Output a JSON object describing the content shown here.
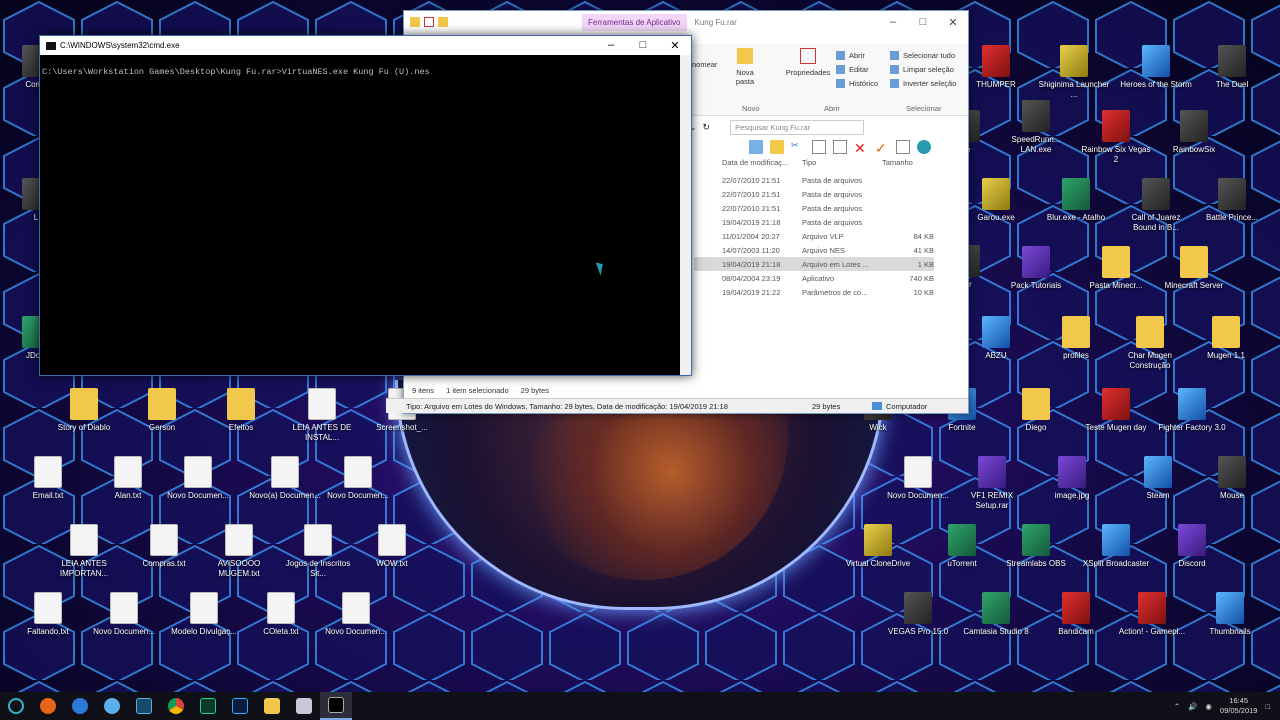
{
  "cmd": {
    "title": "C:\\WINDOWS\\system32\\cmd.exe",
    "line": "C:\\Users\\Workstation Games\\Desktop\\Kung Fu.rar>VirtuaNES.exe Kung Fu (U).nes"
  },
  "explorer": {
    "context_tab": "Ferramentas de Aplicativo",
    "folder_name": "Kung Fu.rar",
    "ribbon": {
      "rename": "nomear",
      "new_folder": "Nova pasta",
      "properties": "Propriedades",
      "open": "Abrir",
      "edit": "Editar",
      "history": "Histórico",
      "select_all": "Selecionar tudo",
      "select_none": "Limpar seleção",
      "invert": "Inverter seleção",
      "group_new": "Novo",
      "group_open": "Abrir",
      "group_select": "Selecionar"
    },
    "search_placeholder": "Pesquisar Kung Fu.rar",
    "columns": {
      "date": "Data de modificaç...",
      "type": "Tipo",
      "size": "Tamanho"
    },
    "rows": [
      {
        "date": "22/07/2010 21:51",
        "type": "Pasta de arquivos",
        "size": ""
      },
      {
        "date": "22/07/2010 21:51",
        "type": "Pasta de arquivos",
        "size": ""
      },
      {
        "date": "22/07/2010 21:51",
        "type": "Pasta de arquivos",
        "size": ""
      },
      {
        "date": "19/04/2019 21:18",
        "type": "Pasta de arquivos",
        "size": ""
      },
      {
        "date": "11/01/2004 20:27",
        "type": "Arquivo VLP",
        "size": "84 KB"
      },
      {
        "date": "14/07/2003 11:20",
        "type": "Arquivo NES",
        "size": "41 KB"
      },
      {
        "date": "19/04/2019 21:18",
        "type": "Arquivo em Lotes ...",
        "size": "1 KB"
      },
      {
        "date": "08/04/2004 23:19",
        "type": "Aplicativo",
        "size": "740 KB"
      },
      {
        "date": "19/04/2019 21:22",
        "type": "Parâmetros de co...",
        "size": "10 KB"
      }
    ],
    "status": {
      "items": "9 itens",
      "selected": "1 item selecionado",
      "bytes": "29 bytes"
    },
    "info": {
      "details": "Tipo: Arquivo em Lotes do Windows, Tamanho: 29 bytes, Data de modificação: 19/04/2019 21:18",
      "size": "29 bytes",
      "location": "Computador"
    }
  },
  "desktop_icons": [
    {
      "label": "THUMPER",
      "kind": "red"
    },
    {
      "label": "Shiginima Launcher ...",
      "kind": "yellow"
    },
    {
      "label": "Heroes of the Storm",
      "kind": "blue"
    },
    {
      "label": "The Duel",
      "kind": "dark"
    },
    {
      "label": "SpeedRunn... LAN.exe",
      "kind": "dark"
    },
    {
      "label": "Rainbow Six Vegas 2",
      "kind": "red"
    },
    {
      "label": "RainbowSix",
      "kind": "dark"
    },
    {
      "label": "Garou.exe",
      "kind": "yellow"
    },
    {
      "label": "Blur.exe - Atalho",
      "kind": "green"
    },
    {
      "label": "Call of Juarez Bound in B...",
      "kind": "dark"
    },
    {
      "label": "Battle Prince...",
      "kind": "dark"
    },
    {
      "label": "Pack Tutoriais",
      "kind": "purple"
    },
    {
      "label": "Pasta Minecr...",
      "kind": "folder"
    },
    {
      "label": "Minecraft Server",
      "kind": "folder"
    },
    {
      "label": "ABZU",
      "kind": "blue"
    },
    {
      "label": "profiles",
      "kind": "folder"
    },
    {
      "label": "Char Mugen Construção",
      "kind": "folder"
    },
    {
      "label": "Mugen 1.1",
      "kind": "folder"
    },
    {
      "label": "Story of Diablo",
      "kind": "folder"
    },
    {
      "label": "Gerson",
      "kind": "folder"
    },
    {
      "label": "Efeitos",
      "kind": "folder"
    },
    {
      "label": "LEIA ANTES DE INSTAL...",
      "kind": "doc"
    },
    {
      "label": "Screenshot_...",
      "kind": "doc"
    },
    {
      "label": "Wick",
      "kind": "dark"
    },
    {
      "label": "Fortnite",
      "kind": "blue"
    },
    {
      "label": "Diego",
      "kind": "folder"
    },
    {
      "label": "Teste Mugen day",
      "kind": "red"
    },
    {
      "label": "Fighter Factory 3.0",
      "kind": "blue"
    },
    {
      "label": "Email.txt",
      "kind": "doc"
    },
    {
      "label": "Alan.txt",
      "kind": "doc"
    },
    {
      "label": "Novo Documen...",
      "kind": "doc"
    },
    {
      "label": "Novo(a) Documen...",
      "kind": "doc"
    },
    {
      "label": "Novo Documen...",
      "kind": "doc"
    },
    {
      "label": "Novo Documen...",
      "kind": "doc"
    },
    {
      "label": "VF1 REMIX Setup.rar",
      "kind": "purple"
    },
    {
      "label": "image.jpg",
      "kind": "purple"
    },
    {
      "label": "Steam",
      "kind": "blue"
    },
    {
      "label": "Mouse",
      "kind": "dark"
    },
    {
      "label": "LEIA ANTES IMPORTAN...",
      "kind": "doc"
    },
    {
      "label": "Compras.txt",
      "kind": "doc"
    },
    {
      "label": "AVISOOOO MUGEM.txt",
      "kind": "doc"
    },
    {
      "label": "Jogos de Inscritos Sit...",
      "kind": "doc"
    },
    {
      "label": "WOW.txt",
      "kind": "doc"
    },
    {
      "label": "Virtual CloneDrive",
      "kind": "yellow"
    },
    {
      "label": "uTorrent",
      "kind": "green"
    },
    {
      "label": "Streamlabs OBS",
      "kind": "green"
    },
    {
      "label": "XSplit Broadcaster",
      "kind": "blue"
    },
    {
      "label": "Discord",
      "kind": "purple"
    },
    {
      "label": "Faltando.txt",
      "kind": "doc"
    },
    {
      "label": "Novo Documen...",
      "kind": "doc"
    },
    {
      "label": "Modelo Divulgaç...",
      "kind": "doc"
    },
    {
      "label": "COleta.txt",
      "kind": "doc"
    },
    {
      "label": "Novo Documen...",
      "kind": "doc"
    },
    {
      "label": "VEGAS Pro 15.0",
      "kind": "dark"
    },
    {
      "label": "Camtasia Studio 8",
      "kind": "green"
    },
    {
      "label": "Bandicam",
      "kind": "red"
    },
    {
      "label": "Action! - Gamepl...",
      "kind": "red"
    },
    {
      "label": "Thumbnails",
      "kind": "blue"
    },
    {
      "label": "JDow",
      "kind": "green"
    },
    {
      "label": "Comp",
      "kind": "dark"
    },
    {
      "label": "ger",
      "kind": "dark"
    },
    {
      "label": "ne",
      "kind": "dark"
    },
    {
      "label": "L",
      "kind": "dark"
    }
  ],
  "taskbar": {
    "items": [
      "cortana",
      "firefox",
      "edge",
      "explorer-globe",
      "vegas",
      "chrome",
      "audition",
      "photoshop",
      "file-explorer",
      "outlook",
      "cmd"
    ],
    "time": "16:45",
    "date": "09/05/2019"
  }
}
